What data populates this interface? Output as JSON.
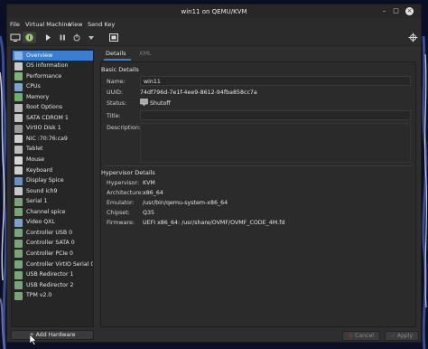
{
  "window": {
    "title": "win11 on QEMU/KVM",
    "controls": {
      "minimize": "–",
      "maximize": "□",
      "close": "×"
    }
  },
  "menubar": [
    "File",
    "Virtual Machine",
    "View",
    "Send Key"
  ],
  "toolbar": {
    "icons": [
      "console-icon",
      "info-icon",
      "run-icon",
      "pause-icon",
      "shutdown-icon",
      "dropdown-icon",
      "screenshot-icon",
      "crosshair-icon"
    ]
  },
  "sidebar": {
    "items": [
      {
        "label": "Overview",
        "icon": "overview-icon",
        "color": "#8fb4e0"
      },
      {
        "label": "OS information",
        "icon": "os-info-icon",
        "color": "#c8c8c8"
      },
      {
        "label": "Performance",
        "icon": "performance-icon",
        "color": "#7fb37a"
      },
      {
        "label": "CPUs",
        "icon": "cpu-icon",
        "color": "#7ea3d0"
      },
      {
        "label": "Memory",
        "icon": "memory-icon",
        "color": "#6fae6a"
      },
      {
        "label": "Boot Options",
        "icon": "gear-icon",
        "color": "#b8b8b8"
      },
      {
        "label": "SATA CDROM 1",
        "icon": "cdrom-icon",
        "color": "#c4c4c4"
      },
      {
        "label": "VirtIO Disk 1",
        "icon": "disk-icon",
        "color": "#9a9a9a"
      },
      {
        "label": "NIC :70:76:ca9",
        "icon": "nic-icon",
        "color": "#d0d0d0"
      },
      {
        "label": "Tablet",
        "icon": "tablet-icon",
        "color": "#bdbdbd"
      },
      {
        "label": "Mouse",
        "icon": "mouse-icon",
        "color": "#d6d6d6"
      },
      {
        "label": "Keyboard",
        "icon": "keyboard-icon",
        "color": "#cfcfcf"
      },
      {
        "label": "Display Spice",
        "icon": "display-icon",
        "color": "#6e8fc2"
      },
      {
        "label": "Sound ich9",
        "icon": "sound-icon",
        "color": "#c9c9c9"
      },
      {
        "label": "Serial 1",
        "icon": "serial-icon",
        "color": "#7ba27a"
      },
      {
        "label": "Channel spice",
        "icon": "channel-icon",
        "color": "#7aa37a"
      },
      {
        "label": "Video QXL",
        "icon": "video-icon",
        "color": "#7f9fc8"
      },
      {
        "label": "Controller USB 0",
        "icon": "controller-icon",
        "color": "#7ba27a"
      },
      {
        "label": "Controller SATA 0",
        "icon": "controller-icon",
        "color": "#7ba27a"
      },
      {
        "label": "Controller PCIe 0",
        "icon": "controller-icon",
        "color": "#7ba27a"
      },
      {
        "label": "Controller VirtIO Serial 0",
        "icon": "controller-icon",
        "color": "#7ba27a"
      },
      {
        "label": "USB Redirector 1",
        "icon": "usb-icon",
        "color": "#7ba27a"
      },
      {
        "label": "USB Redirector 2",
        "icon": "usb-icon",
        "color": "#7ba27a"
      },
      {
        "label": "TPM v2.0",
        "icon": "tpm-icon",
        "color": "#7ba27a"
      }
    ],
    "selected_index": 0,
    "accent": "#3a7fcf"
  },
  "add_hardware": {
    "label": "Add Hardware",
    "icon": "+"
  },
  "tabs": [
    {
      "label": "Details",
      "active": true
    },
    {
      "label": "XML",
      "active": false
    }
  ],
  "basic": {
    "heading": "Basic Details",
    "name_label": "Name:",
    "name_value": "win11",
    "uuid_label": "UUID:",
    "uuid_value": "74df796d-7e1f-4ee9-8612-94fba858cc7a",
    "status_label": "Status:",
    "status_value": "Shutoff",
    "title_label": "Title:",
    "title_value": "",
    "description_label": "Description:",
    "description_value": ""
  },
  "hypervisor": {
    "heading": "Hypervisor Details",
    "rows": [
      {
        "label": "Hypervisor:",
        "value": "KVM"
      },
      {
        "label": "Architecture:",
        "value": "x86_64"
      },
      {
        "label": "Emulator:",
        "value": "/usr/bin/qemu-system-x86_64"
      },
      {
        "label": "Chipset:",
        "value": "Q35"
      },
      {
        "label": "Firmware:",
        "value": "UEFI x86_64: /usr/share/OVMF/OVMF_CODE_4M.fd"
      }
    ]
  },
  "buttons": {
    "cancel": "Cancel",
    "apply": "Apply"
  }
}
